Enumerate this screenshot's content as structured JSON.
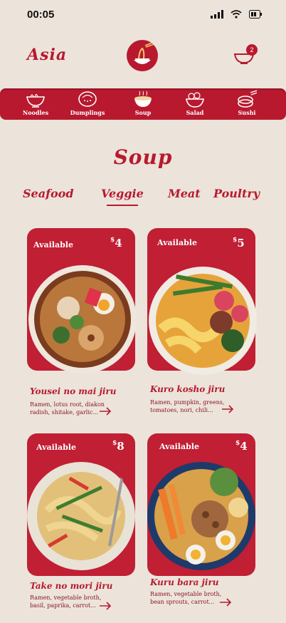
{
  "status": {
    "time": "00:05"
  },
  "header": {
    "brand": "Asia",
    "cart_count": "2"
  },
  "categories": [
    {
      "label": "Noodles",
      "icon": "noodles-bowl-icon"
    },
    {
      "label": "Dumplings",
      "icon": "dumplings-icon"
    },
    {
      "label": "Soup",
      "icon": "soup-bowl-icon"
    },
    {
      "label": "Salad",
      "icon": "salad-icon"
    },
    {
      "label": "Sushi",
      "icon": "sushi-icon"
    }
  ],
  "section": {
    "title": "Soup"
  },
  "tabs": [
    "Seafood",
    "Veggie",
    "Meat",
    "Poultry"
  ],
  "active_tab": "Veggie",
  "products": [
    {
      "availability": "Available",
      "currency": "$",
      "price": "4",
      "name": "Yousei no mai jiru",
      "description": "Ramen, lotus root, diakon radish, shitake, garlic..."
    },
    {
      "availability": "Available",
      "currency": "$",
      "price": "5",
      "name": "Kuro kosho jiru",
      "description": "Ramen, pumpkin, greens, tomatoes, nori, chili..."
    },
    {
      "availability": "Available",
      "currency": "$",
      "price": "8",
      "name": "Take no mori jiru",
      "description": "Ramen, vegetable broth, basil, paprika, carrot..."
    },
    {
      "availability": "Available",
      "currency": "$",
      "price": "4",
      "name": "Kuru bara jiru",
      "description": "Ramen, vegetable broth, bean sprouts, carrot..."
    }
  ],
  "colors": {
    "accent": "#B8192F",
    "background": "#ECE4DA"
  }
}
